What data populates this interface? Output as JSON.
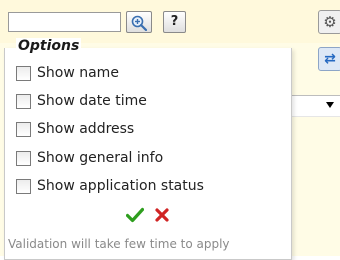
{
  "search": {
    "value": "",
    "placeholder": ""
  },
  "toolbar": {
    "help_label": "?"
  },
  "options": {
    "title": "Options",
    "items": [
      {
        "label": "Show name",
        "checked": false
      },
      {
        "label": "Show date time",
        "checked": false
      },
      {
        "label": "Show address",
        "checked": false
      },
      {
        "label": "Show general info",
        "checked": false
      },
      {
        "label": "Show application status",
        "checked": false
      }
    ],
    "note": "Validation will take few time to apply"
  },
  "icons": {
    "zoom": "magnifier-plus-icon",
    "help": "help-icon",
    "gear": "gear-icon",
    "refresh": "refresh-icon",
    "ok": "checkmark-icon",
    "cancel": "cross-icon"
  },
  "colors": {
    "ok_green": "#2e9e1e",
    "cancel_red": "#d02424",
    "background_panel": "#fffce6"
  }
}
